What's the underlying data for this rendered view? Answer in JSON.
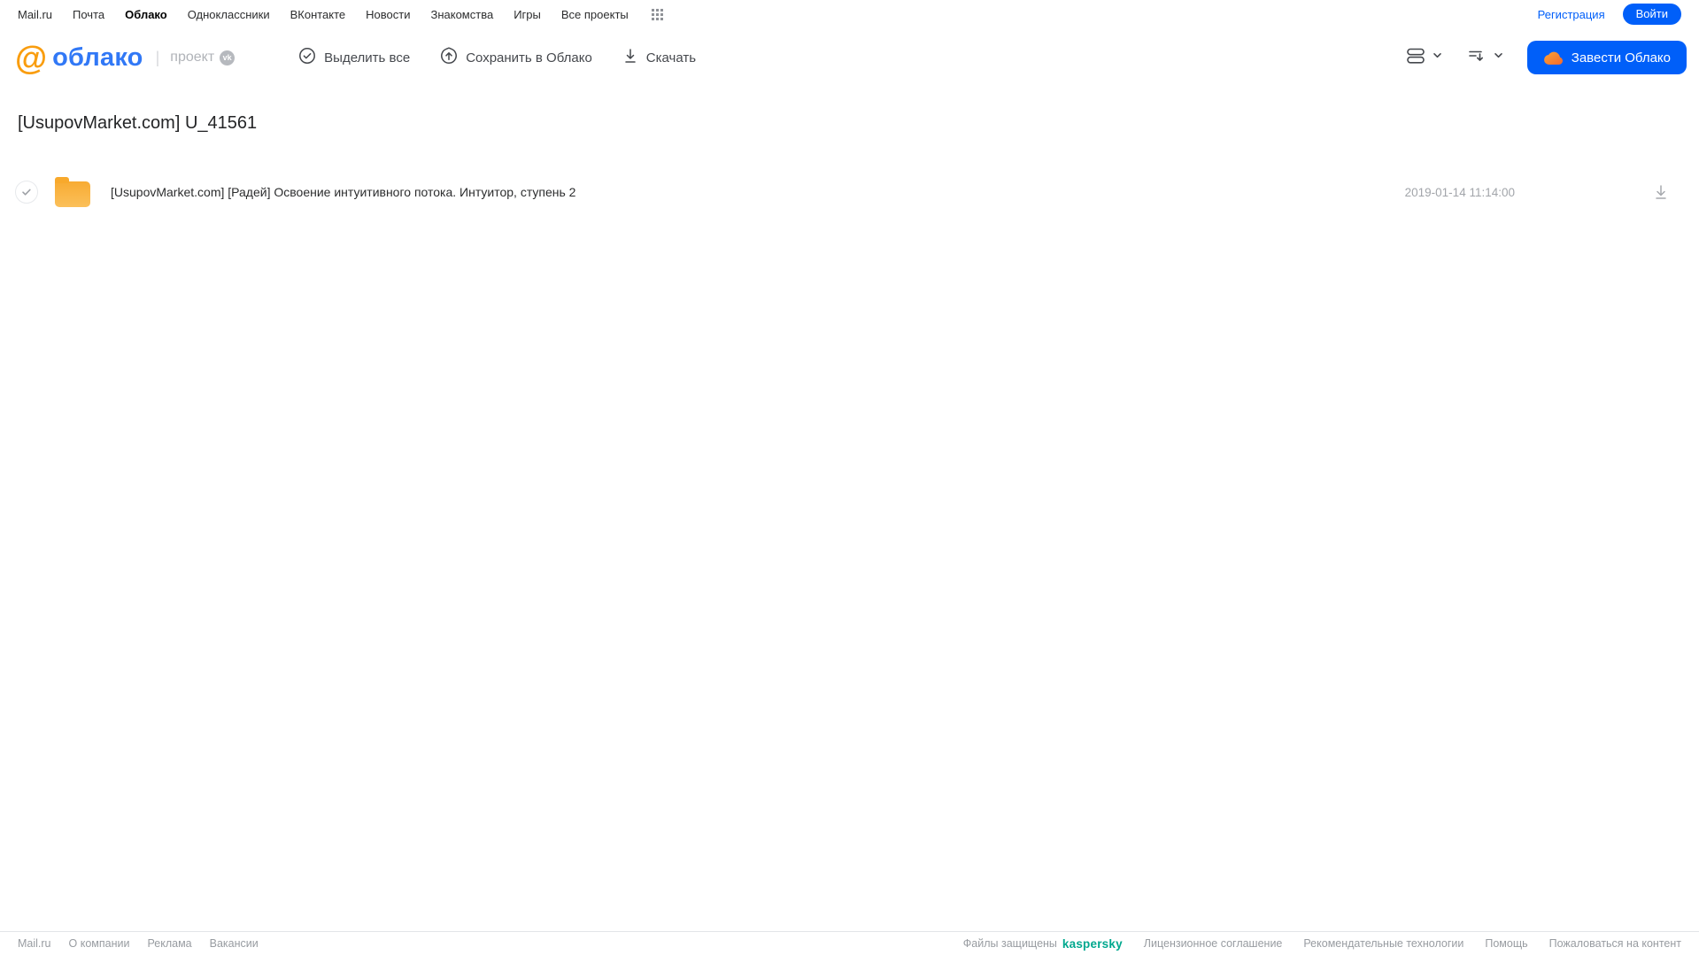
{
  "top_nav": {
    "items": [
      {
        "label": "Mail.ru"
      },
      {
        "label": "Почта"
      },
      {
        "label": "Облако"
      },
      {
        "label": "Одноклассники"
      },
      {
        "label": "ВКонтакте"
      },
      {
        "label": "Новости"
      },
      {
        "label": "Знакомства"
      },
      {
        "label": "Игры"
      },
      {
        "label": "Все проекты"
      }
    ],
    "registration_label": "Регистрация",
    "login_label": "Войти"
  },
  "header": {
    "logo": {
      "at_symbol": "@",
      "brand": "облако",
      "divider": "|",
      "project_label": "проект",
      "vk_badge": "vk"
    },
    "toolbar": {
      "select_all_label": "Выделить все",
      "save_to_cloud_label": "Сохранить в Облако",
      "download_label": "Скачать"
    },
    "get_cloud_button_label": "Завести Облако"
  },
  "page": {
    "title": "[UsupovMarket.com] U_41561"
  },
  "files": [
    {
      "type": "folder",
      "name": "[UsupovMarket.com] [Радей] Освоение интуитивного потока. Интуитор, ступень 2",
      "date": "2019-01-14 11:14:00"
    }
  ],
  "footer": {
    "left_links": [
      "Mail.ru",
      "О компании",
      "Реклама",
      "Вакансии"
    ],
    "protected_text": "Файлы защищены",
    "kaspersky_brand": "kaspersky",
    "right_links": [
      "Лицензионное соглашение",
      "Рекомендательные технологии",
      "Помощь",
      "Пожаловаться на контент"
    ]
  },
  "colors": {
    "accent_blue": "#005ff9",
    "logo_blue": "#3178f6",
    "logo_orange": "#f99d0f",
    "folder_yellow": "#fbb13c",
    "kaspersky_green": "#00a88e"
  }
}
